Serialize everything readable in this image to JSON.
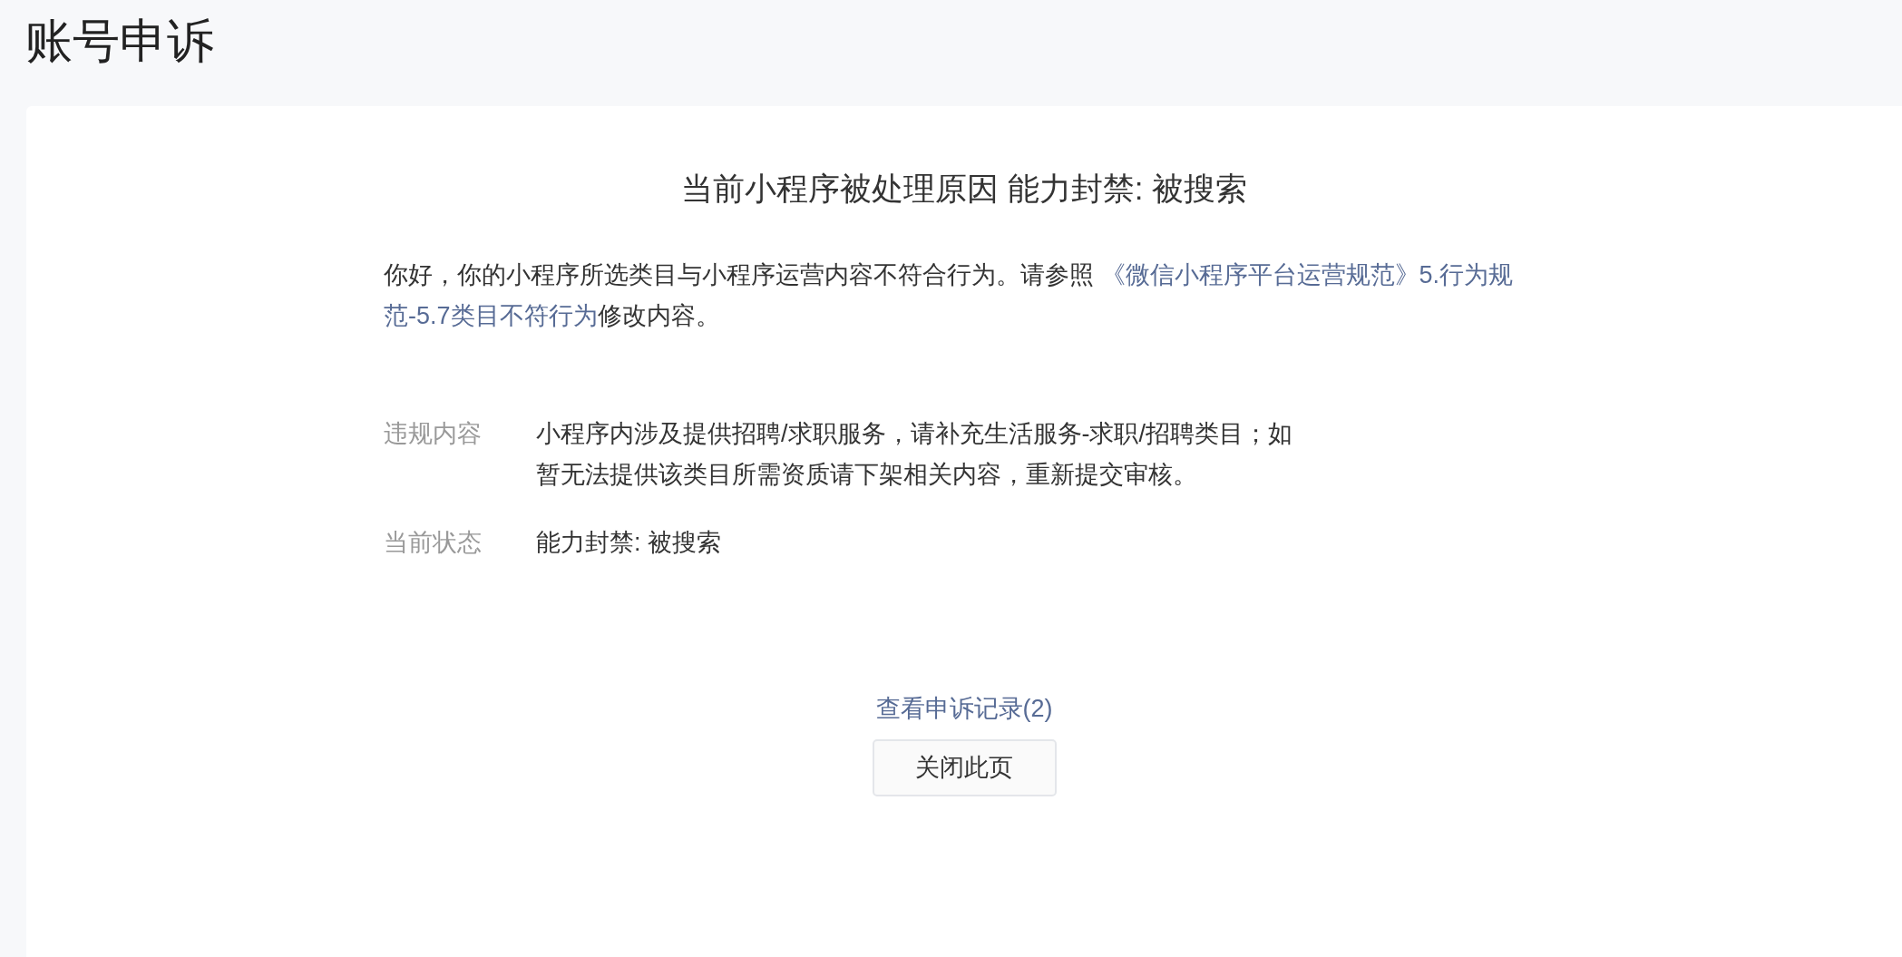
{
  "page_title": "账号申诉",
  "card": {
    "heading": "当前小程序被处理原因 能力封禁: 被搜索",
    "intro_lines": [
      [
        {
          "kind": "text",
          "text": "你好，你的小程序所选类目与小程序运营内容不符合行为。请参照 "
        },
        {
          "kind": "link",
          "text": "《微信小程序平台运营规范》5.行为规"
        }
      ],
      [
        {
          "kind": "link",
          "text": "范-5.7类目不符行为"
        },
        {
          "kind": "text",
          "text": "修改内容。"
        }
      ]
    ],
    "details": [
      {
        "label": "违规内容",
        "value": "小程序内涉及提供招聘/求职服务，请补充生活服务-求职/招聘类目；如暂无法提供该类目所需资质请下架相关内容，重新提交审核。"
      },
      {
        "label": "当前状态",
        "value": "能力封禁: 被搜索"
      }
    ],
    "history_link": "查看申诉记录(2)",
    "close_button": "关闭此页"
  }
}
